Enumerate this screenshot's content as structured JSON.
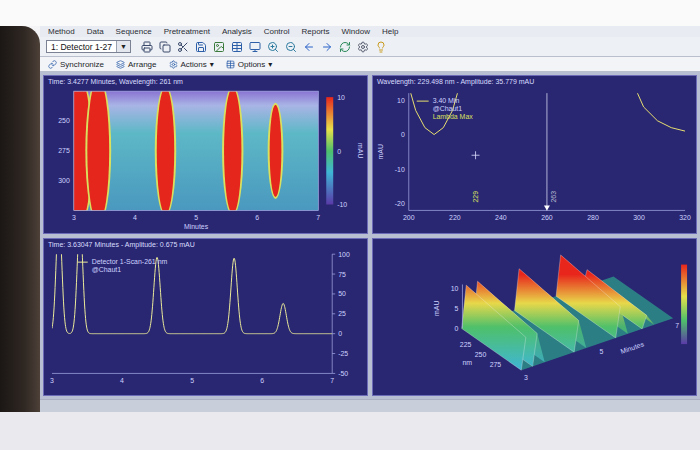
{
  "menu": [
    "Method",
    "Data",
    "Sequence",
    "Pretreatment",
    "Analysis",
    "Control",
    "Reports",
    "Window",
    "Help"
  ],
  "toolbar": {
    "detector": "1: Detector 1-27",
    "detector_arrow": "▼"
  },
  "view_toolbar": [
    {
      "label": "Synchronize",
      "arrow": ""
    },
    {
      "label": "Arrange",
      "arrow": ""
    },
    {
      "label": "Actions",
      "arrow": "▾"
    },
    {
      "label": "Options",
      "arrow": "▾"
    }
  ],
  "peaks": [
    {
      "time": 3.1,
      "height": 150,
      "width": 0.04
    },
    {
      "time": 3.4,
      "height": 140,
      "width": 0.04
    },
    {
      "time": 4.5,
      "height": 96,
      "width": 0.045
    },
    {
      "time": 5.6,
      "height": 95,
      "width": 0.045
    },
    {
      "time": 6.3,
      "height": 38,
      "width": 0.045
    }
  ],
  "contour": {
    "header": "Time: 3.4277 Minutes, Wavelength: 261 nm",
    "y_ticks": [
      "250",
      "275",
      "300"
    ],
    "x_ticks": [
      "3",
      "4",
      "5",
      "6",
      "7"
    ],
    "x_label": "Minutes",
    "scale_ticks": [
      "10",
      "0",
      "-10"
    ],
    "scale_unit": "mAU"
  },
  "spectrum": {
    "header": "Wavelength: 229.498 nm - Amplitude: 35.779 mAU",
    "legend": [
      "3.40 Min",
      "@Chaut1",
      "Lambda Max"
    ],
    "y_label": "mAU",
    "y_ticks": [
      "10",
      "0",
      "-10",
      "-20"
    ],
    "x_ticks": [
      "200",
      "220",
      "240",
      "260",
      "280",
      "300",
      "320"
    ],
    "markers": [
      {
        "label": "229",
        "value": 229,
        "crosshair": true
      },
      {
        "label": "263",
        "value": 263,
        "crosshair": false
      }
    ],
    "cursor": 260,
    "segments": [
      [
        [
          200,
          14
        ],
        [
          203,
          7
        ],
        [
          207,
          2
        ],
        [
          211,
          0
        ],
        [
          215,
          2
        ],
        [
          219,
          7
        ],
        [
          222,
          14
        ]
      ],
      [
        [
          298,
          14
        ],
        [
          302,
          8
        ],
        [
          308,
          4
        ],
        [
          314,
          2
        ],
        [
          320,
          1
        ]
      ]
    ]
  },
  "chromatogram": {
    "header": "Time: 3.63047 Minutes - Amplitude: 0.675 mAU",
    "legend": [
      "Detector 1-Scan-261 nm",
      "@Chaut1"
    ],
    "y_ticks": [
      "100",
      "75",
      "50",
      "25",
      "0",
      "-25",
      "-50"
    ],
    "x_ticks": [
      "3",
      "4",
      "5",
      "6",
      "7"
    ]
  },
  "surface": {
    "z_label": "mAU",
    "z_ticks": [
      "10",
      "5",
      "0"
    ],
    "y_label": "nm",
    "y_ticks": [
      "225",
      "250",
      "275"
    ],
    "x_label": "Minutes",
    "x_ticks": [
      "3",
      "5",
      "7"
    ]
  }
}
